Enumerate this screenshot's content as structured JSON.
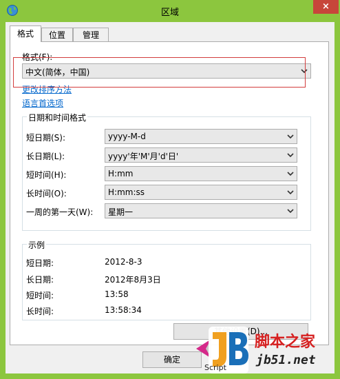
{
  "window": {
    "title": "区域",
    "close_label": "×"
  },
  "tabs": [
    {
      "label": "格式",
      "active": true
    },
    {
      "label": "位置",
      "active": false
    },
    {
      "label": "管理",
      "active": false
    }
  ],
  "format": {
    "label": "格式(F):",
    "value": "中文(简体，中国)",
    "link_sort": "更改排序方法",
    "link_language": "语言首选项"
  },
  "datetime": {
    "group_title": "日期和时间格式",
    "rows": [
      {
        "label": "短日期(S):",
        "value": "yyyy-M-d"
      },
      {
        "label": "长日期(L):",
        "value": "yyyy'年'M'月'd'日'"
      },
      {
        "label": "短时间(H):",
        "value": "H:mm"
      },
      {
        "label": "长时间(O):",
        "value": "H:mm:ss"
      },
      {
        "label": "一周的第一天(W):",
        "value": "星期一"
      }
    ]
  },
  "examples": {
    "group_title": "示例",
    "rows": [
      {
        "label": "短日期:",
        "value": "2012-8-3"
      },
      {
        "label": "长日期:",
        "value": "2012年8月3日"
      },
      {
        "label": "短时间:",
        "value": "13:58"
      },
      {
        "label": "长时间:",
        "value": "13:58:34"
      }
    ]
  },
  "buttons": {
    "other_settings": "其他设置(D)...",
    "ok": "确定"
  },
  "watermark": {
    "site_name": "脚本之家",
    "domain": "jb51.net",
    "script_word": "Script"
  }
}
